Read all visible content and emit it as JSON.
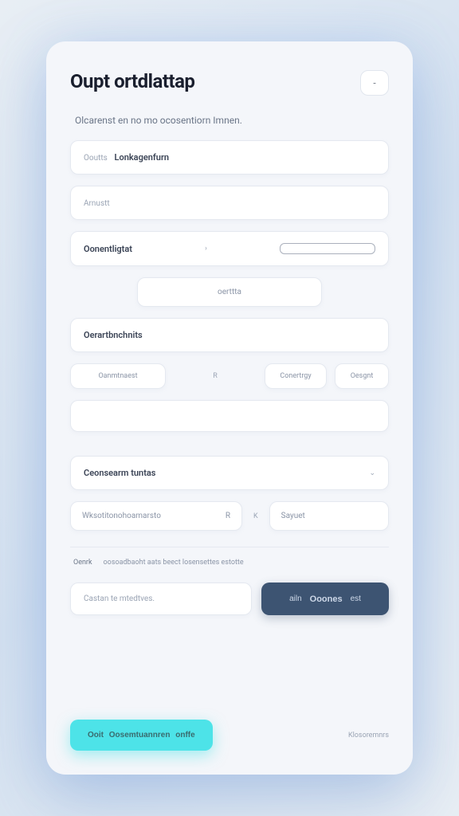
{
  "header": {
    "title": "Oupt ortdlattap",
    "icon_label": "-"
  },
  "subtitle": "Olcarenst en no mo ocosentiorn Imnen.",
  "fields": {
    "f1_prefix": "Ooutts",
    "f1_value": "Lonkagenfurn",
    "f2_placeholder": "Arnustt",
    "f3_label": "Oonentligtat",
    "f4_label": "oerttta",
    "f5_label": "Oerartbnchnits"
  },
  "pills": {
    "p1": "Oanmtnaest",
    "mid": "R",
    "p2": "Conertrgy",
    "p3": "Oesgnt"
  },
  "dropdown": {
    "label": "Ceonsearm tuntas",
    "chevron": "⌄"
  },
  "split": {
    "left_text": "Wksotitonohoamarsto",
    "left_suffix": "R",
    "mid": "K",
    "right_text": "Sayuet"
  },
  "note": {
    "label": "Oenrk",
    "text": "oosoadbaoht aats beect losensettes estotte"
  },
  "actions": {
    "input_placeholder": "Castan te mtedtves.",
    "primary_left": "ailn",
    "primary_main": "Ooones",
    "primary_right": "est"
  },
  "footer": {
    "accent_prefix": "Ooit",
    "accent_main": "Oosemtuannren",
    "accent_suffix": "onffe",
    "link": "Klosoremnrs"
  }
}
